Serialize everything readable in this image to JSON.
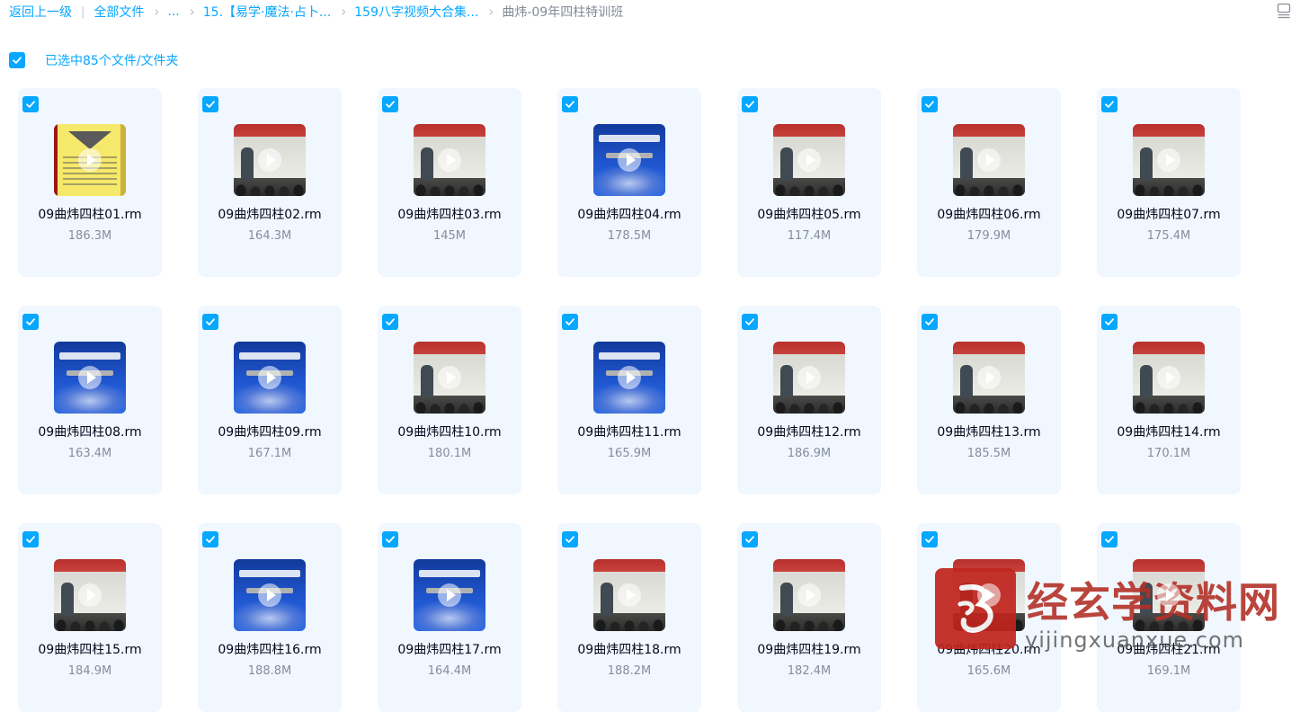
{
  "breadcrumb": {
    "back": "返回上一级",
    "all_files": "全部文件",
    "ellipsis": "...",
    "folder1": "15.【易学·魔法·占卜...",
    "folder2": "159八字视频大合集...",
    "current": "曲炜-09年四柱特训班"
  },
  "selection": {
    "label": "已选中85个文件/文件夹",
    "all_checked": true
  },
  "files": [
    {
      "name": "09曲炜四柱01.rm",
      "size": "186.3M",
      "thumb": "book"
    },
    {
      "name": "09曲炜四柱02.rm",
      "size": "164.3M",
      "thumb": "classroom"
    },
    {
      "name": "09曲炜四柱03.rm",
      "size": "145M",
      "thumb": "classroom"
    },
    {
      "name": "09曲炜四柱04.rm",
      "size": "178.5M",
      "thumb": "title"
    },
    {
      "name": "09曲炜四柱05.rm",
      "size": "117.4M",
      "thumb": "classroom"
    },
    {
      "name": "09曲炜四柱06.rm",
      "size": "179.9M",
      "thumb": "classroom"
    },
    {
      "name": "09曲炜四柱07.rm",
      "size": "175.4M",
      "thumb": "classroom"
    },
    {
      "name": "09曲炜四柱08.rm",
      "size": "163.4M",
      "thumb": "title"
    },
    {
      "name": "09曲炜四柱09.rm",
      "size": "167.1M",
      "thumb": "title"
    },
    {
      "name": "09曲炜四柱10.rm",
      "size": "180.1M",
      "thumb": "classroom"
    },
    {
      "name": "09曲炜四柱11.rm",
      "size": "165.9M",
      "thumb": "title"
    },
    {
      "name": "09曲炜四柱12.rm",
      "size": "186.9M",
      "thumb": "classroom"
    },
    {
      "name": "09曲炜四柱13.rm",
      "size": "185.5M",
      "thumb": "classroom"
    },
    {
      "name": "09曲炜四柱14.rm",
      "size": "170.1M",
      "thumb": "classroom"
    },
    {
      "name": "09曲炜四柱15.rm",
      "size": "184.9M",
      "thumb": "classroom"
    },
    {
      "name": "09曲炜四柱16.rm",
      "size": "188.8M",
      "thumb": "title"
    },
    {
      "name": "09曲炜四柱17.rm",
      "size": "164.4M",
      "thumb": "title"
    },
    {
      "name": "09曲炜四柱18.rm",
      "size": "188.2M",
      "thumb": "classroom"
    },
    {
      "name": "09曲炜四柱19.rm",
      "size": "182.4M",
      "thumb": "classroom"
    },
    {
      "name": "09曲炜四柱20.rm",
      "size": "165.6M",
      "thumb": "classroom"
    },
    {
      "name": "09曲炜四柱21.rm",
      "size": "169.1M",
      "thumb": "classroom"
    }
  ],
  "watermark": {
    "text": "经玄学资料网",
    "url": "yijingxuanxue.com"
  },
  "colors": {
    "accent": "#06a7ff",
    "card_bg": "#f0f7ff",
    "watermark_red": "#c0241d"
  }
}
